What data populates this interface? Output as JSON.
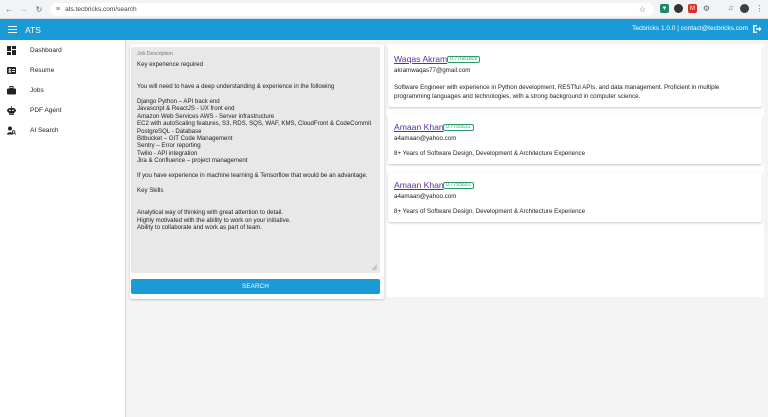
{
  "browser": {
    "url": "ats.tecbricks.com/search"
  },
  "appbar": {
    "title": "ATS",
    "right_text": "Tecbricks 1.0.0 | contact@tecbricks.com"
  },
  "sidebar": {
    "items": [
      {
        "label": "Dashboard",
        "icon": "dashboard-icon"
      },
      {
        "label": "Resume",
        "icon": "resume-icon"
      },
      {
        "label": "Jobs",
        "icon": "jobs-icon"
      },
      {
        "label": "PDF Agent",
        "icon": "robot-icon"
      },
      {
        "label": "AI Search",
        "icon": "person-search-icon"
      }
    ]
  },
  "search": {
    "field_label": "Job Description",
    "text": "Key experience required\n\n\nYou will need to have a deep understanding & experience in the following\n\nDjango Python – API back end\nJavascript & ReactJS - UX front end\nAmazon Web Services AWS - Server infrastructure\nEC2 with autoScaling features, S3, RDS, SQS, WAF, KMS, CloudFront & CodeCommit\nPostgreSQL - Database\nBitbucket – GIT Code Management\nSentry – Error reporting\nTwilio - API integration\nJira & Confluence – project management\n\nIf you have experience in machine learning & Tensorflow that would be an advantage.\n\nKey Skills\n\n\nAnalytical way of thinking with great attention to detail.\nHighly motivated with the ability to work on your initiative.\nAbility to collaborate and work as part of team.",
    "button_label": "SEARCH"
  },
  "results": [
    {
      "name": "Waqas Akram",
      "score": "0.77681809",
      "email": "akramwaqas77@gmail.com",
      "description": "Software Engineer with experience in Python development, RESTful APIs, and data management. Proficient in multiple programming languages and technologies, with a strong background in computer science."
    },
    {
      "name": "Amaan Khan",
      "score": "0.7755631",
      "email": "a4amaan@yahoo.com",
      "description": "8+ Years of Software Design, Development & Architecture Experience"
    },
    {
      "name": "Amaan Khan",
      "score": "0.7755631",
      "email": "a4amaan@yahoo.com",
      "description": "8+ Years of Software Design, Development & Architecture Experience"
    }
  ],
  "colors": {
    "primary": "#1a9bd7",
    "link": "#5a2ea6",
    "score": "#2a9d6a"
  }
}
